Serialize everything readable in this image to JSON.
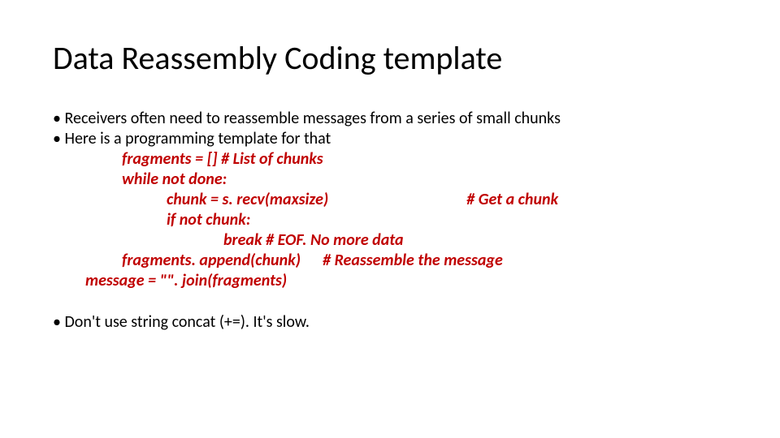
{
  "title": "Data Reassembly Coding template",
  "bullets": {
    "b1": "Receivers often need to reassemble messages from a series of small chunks",
    "b2": "Here is a programming template for that",
    "b3": "Don't use string concat (+=). It's slow."
  },
  "code": {
    "l1": "fragments = [] # List of chunks",
    "l2": "while not done:",
    "l3a": "chunk = s. recv(maxsize)",
    "l3b": "# Get a chunk",
    "l4": "if not chunk:",
    "l5": "break # EOF. No more data",
    "l6": "fragments. append(chunk)      # Reassemble the message",
    "l7": "message = \"\". join(fragments)"
  }
}
